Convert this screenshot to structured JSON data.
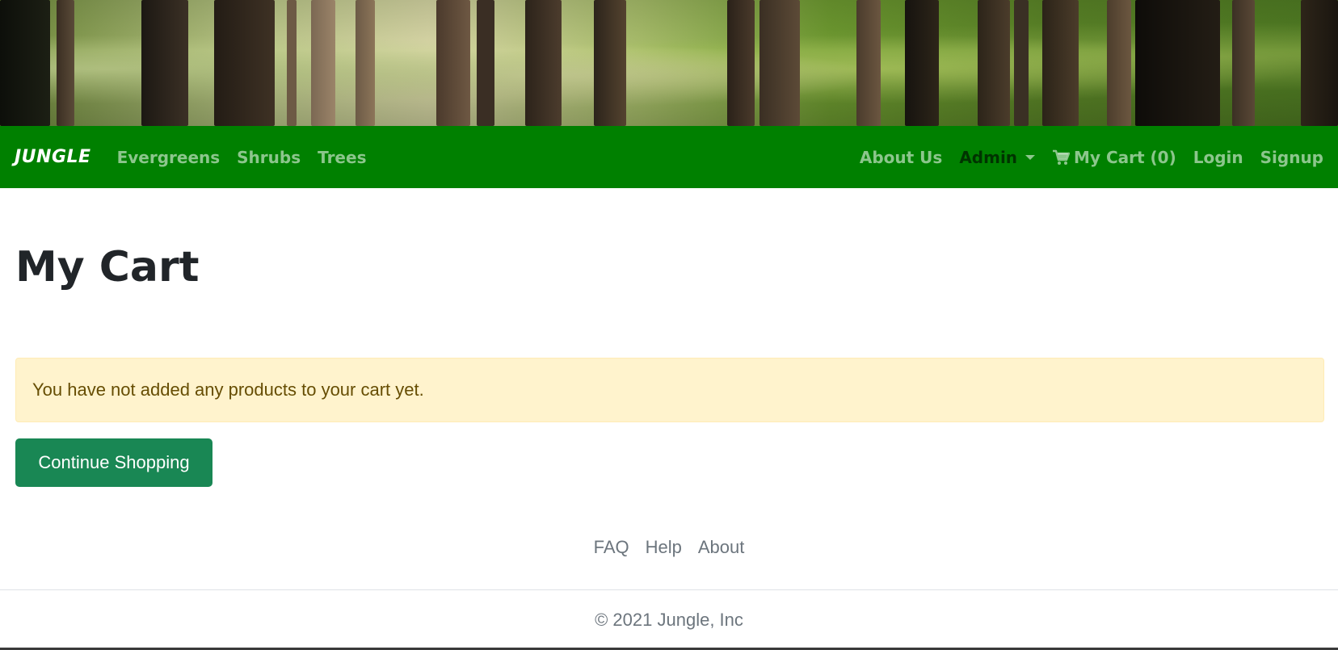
{
  "navbar": {
    "brand": "JUNGLE",
    "links": [
      "Evergreens",
      "Shrubs",
      "Trees"
    ],
    "about": "About Us",
    "admin": "Admin",
    "cart": "My Cart (0)",
    "login": "Login",
    "signup": "Signup",
    "cart_icon": "shopping-cart-icon",
    "admin_icon": "caret-down-icon"
  },
  "main": {
    "title": "My Cart",
    "alert": "You have not added any products to your cart yet.",
    "continue_button": "Continue Shopping"
  },
  "footer": {
    "links": [
      "FAQ",
      "Help",
      "About"
    ],
    "copyright": "© 2021 Jungle, Inc"
  },
  "colors": {
    "navbar_bg": "#008000",
    "alert_bg": "#fff3cd",
    "alert_text": "#664d03",
    "button_bg": "#198754",
    "muted_text": "#6c757d"
  }
}
